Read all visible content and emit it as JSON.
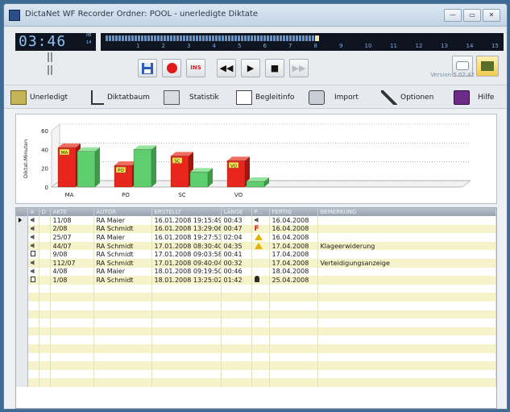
{
  "window": {
    "title": "DictaNet WF Recorder Ordner: POOL - unerledigte Diktate",
    "buttons": [
      "—",
      "▭",
      "✕"
    ]
  },
  "recorder": {
    "time": "03:46",
    "lcd_labels": [
      "08",
      "14"
    ],
    "ticks": [
      "1",
      "2",
      "3",
      "4",
      "5",
      "6",
      "7",
      "8",
      "9",
      "10",
      "11",
      "12",
      "13",
      "14",
      "15"
    ],
    "progress_fraction": 0.52,
    "buttons": {
      "save": "save-icon",
      "record": "record-icon",
      "ins": "INS",
      "rewind": "◀◀",
      "play": "▶",
      "stop": "■",
      "forward": "▶▶"
    },
    "version": "Version 5.02.42"
  },
  "toolbar": {
    "unerledigt": "Unerledigt",
    "diktatbaum": "Diktatbaum",
    "statistik": "Statistik",
    "begleitinfo": "Begleitinfo",
    "import": "Import",
    "optionen": "Optionen",
    "hilfe": "Hilfe"
  },
  "chart_data": {
    "type": "bar",
    "ylabel": "Diktat-Minuten",
    "ylim": [
      0,
      60
    ],
    "yticks": [
      0,
      20,
      40,
      60
    ],
    "categories": [
      "MA",
      "PO",
      "SC",
      "VO"
    ],
    "series": [
      {
        "color": "#e8261b",
        "values": [
          42,
          23,
          33,
          28
        ]
      },
      {
        "color": "#5fcf6d",
        "values": [
          38,
          40,
          16,
          6
        ]
      }
    ],
    "bar_labels": [
      "MA",
      "PO",
      "SC",
      "VO"
    ]
  },
  "table": {
    "headers": [
      "A",
      "D",
      "AKTE",
      "AUTOR",
      "ERSTELLT",
      "LÄNGE",
      "P...",
      "FERTIG",
      "BEMERKUNG"
    ],
    "rows": [
      {
        "selected": true,
        "icon": "speaker-icon",
        "akte": "11/08",
        "autor": "RA Maier",
        "erstellt": "16.01.2008 19:15:49",
        "laenge": "00:43",
        "p": "speaker-icon",
        "fertig": "16.04.2008",
        "bemerkung": ""
      },
      {
        "selected": false,
        "icon": "speaker-icon",
        "akte": "2/08",
        "autor": "RA Schmidt",
        "erstellt": "16.01.2008 13:29:06",
        "laenge": "00:47",
        "p": "F",
        "fertig": "16.04.2008",
        "bemerkung": ""
      },
      {
        "selected": false,
        "icon": "speaker-icon",
        "akte": "25/07",
        "autor": "RA Maier",
        "erstellt": "16.01.2008 19:27:53",
        "laenge": "02:04",
        "p": "warning-icon",
        "fertig": "16.04.2008",
        "bemerkung": ""
      },
      {
        "selected": false,
        "icon": "speaker-icon",
        "akte": "44/07",
        "autor": "RA Schmidt",
        "erstellt": "17.01.2008 08:30:40",
        "laenge": "04:35",
        "p": "warning-icon",
        "fertig": "17.04.2008",
        "bemerkung": "Klageerwiderung"
      },
      {
        "selected": false,
        "icon": "document-icon",
        "akte": "9/08",
        "autor": "RA Schmidt",
        "erstellt": "17.01.2008 09:03:58",
        "laenge": "00:41",
        "p": "",
        "fertig": "17.04.2008",
        "bemerkung": ""
      },
      {
        "selected": false,
        "icon": "speaker-icon",
        "akte": "112/07",
        "autor": "RA Schmidt",
        "erstellt": "17.01.2008 09:40:04",
        "laenge": "00:32",
        "p": "",
        "fertig": "17.04.2008",
        "bemerkung": "Verteidigungsanzeige"
      },
      {
        "selected": false,
        "icon": "speaker-icon",
        "akte": "4/08",
        "autor": "RA Maier",
        "erstellt": "18.01.2008 09:19:50",
        "laenge": "00:46",
        "p": "",
        "fertig": "18.04.2008",
        "bemerkung": ""
      },
      {
        "selected": false,
        "icon": "document-icon",
        "akte": "1/08",
        "autor": "RA Schmidt",
        "erstellt": "18.01.2008 13:25:02",
        "laenge": "01:42",
        "p": "person-icon",
        "fertig": "25.04.2008",
        "bemerkung": ""
      }
    ],
    "empty_rows": 12
  }
}
